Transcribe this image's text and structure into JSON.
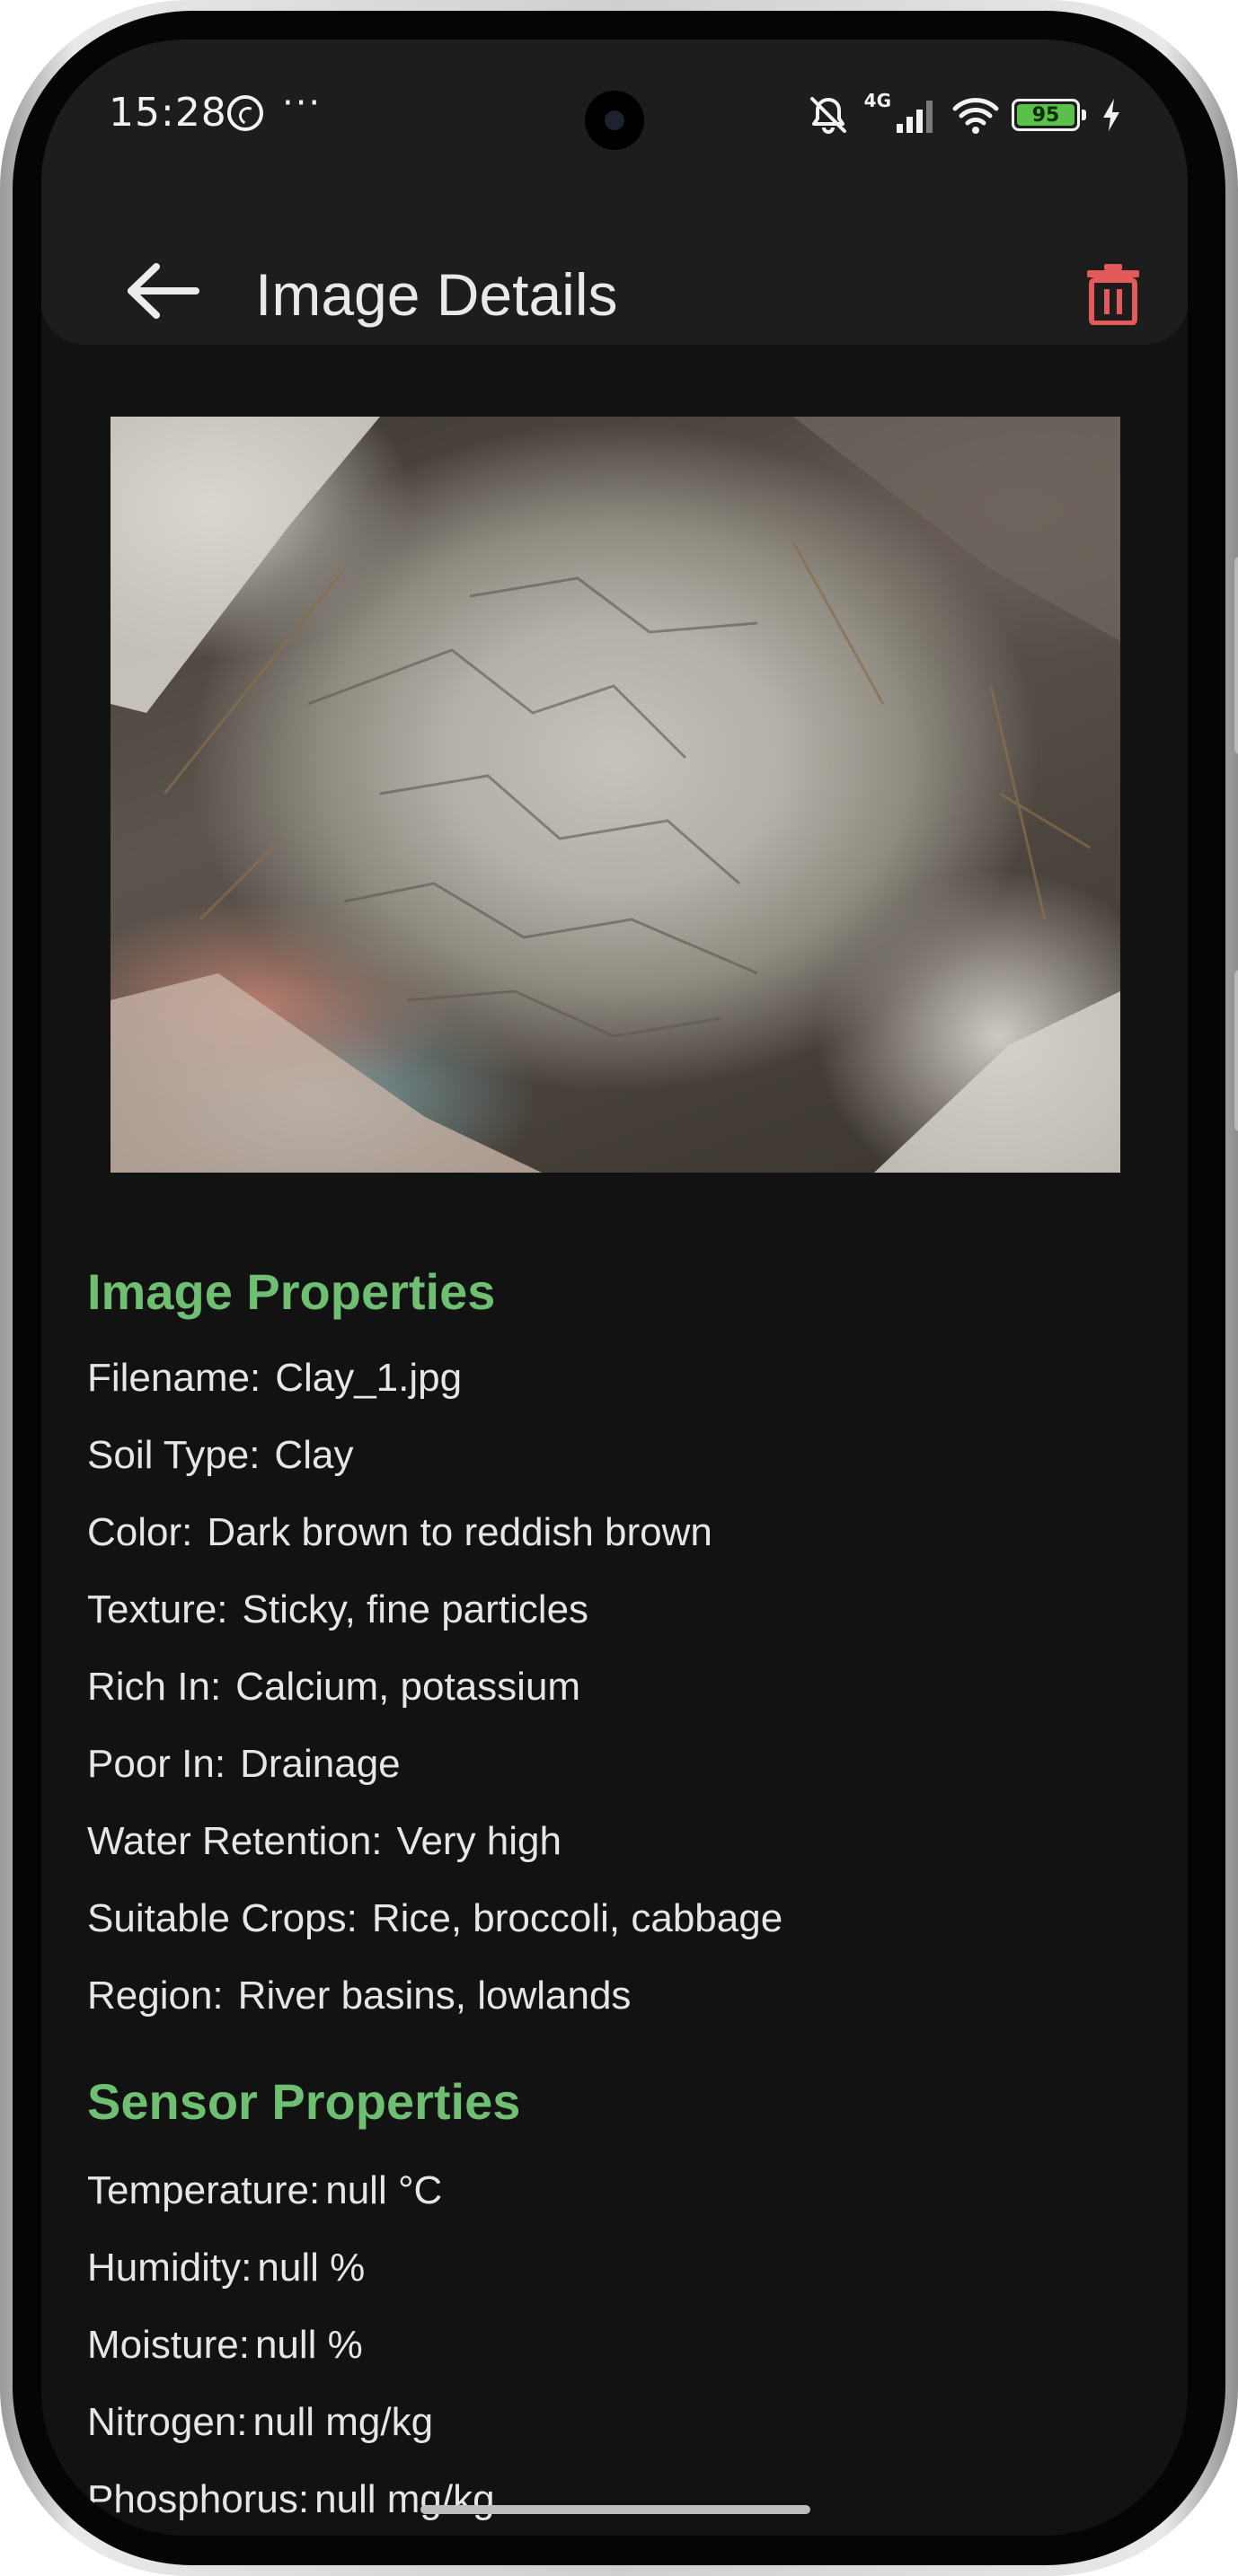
{
  "status_bar": {
    "time": "15:28",
    "more": "···",
    "network": "4G",
    "battery": "95"
  },
  "app_bar": {
    "title": "Image Details"
  },
  "image_properties": {
    "title": "Image Properties",
    "rows": [
      {
        "label": "Filename:",
        "value": "Clay_1.jpg"
      },
      {
        "label": "Soil Type:",
        "value": "Clay"
      },
      {
        "label": "Color:",
        "value": "Dark brown to reddish brown"
      },
      {
        "label": "Texture:",
        "value": "Sticky, fine particles"
      },
      {
        "label": "Rich In:",
        "value": "Calcium, potassium"
      },
      {
        "label": "Poor In:",
        "value": "Drainage"
      },
      {
        "label": "Water Retention:",
        "value": "Very high"
      },
      {
        "label": "Suitable Crops:",
        "value": "Rice, broccoli, cabbage"
      },
      {
        "label": "Region:",
        "value": "River basins, lowlands"
      }
    ]
  },
  "sensor_properties": {
    "title": "Sensor Properties",
    "rows": [
      {
        "label": "Temperature:",
        "value": "null °C"
      },
      {
        "label": "Humidity:",
        "value": "null %"
      },
      {
        "label": "Moisture:",
        "value": "null %"
      },
      {
        "label": "Nitrogen:",
        "value": "null mg/kg"
      },
      {
        "label": "Phosphorus:",
        "value": "null mg/kg"
      }
    ]
  },
  "icons": {
    "back": "arrow-left-icon",
    "delete": "trash-icon",
    "mute": "bell-muted-icon",
    "signal": "signal-icon",
    "wifi": "wifi-icon",
    "charging": "bolt-icon"
  },
  "colors": {
    "accent_green": "#6fbf73",
    "delete_red": "#e25a5a",
    "background": "#121212",
    "app_bar": "#1d1d1d"
  }
}
